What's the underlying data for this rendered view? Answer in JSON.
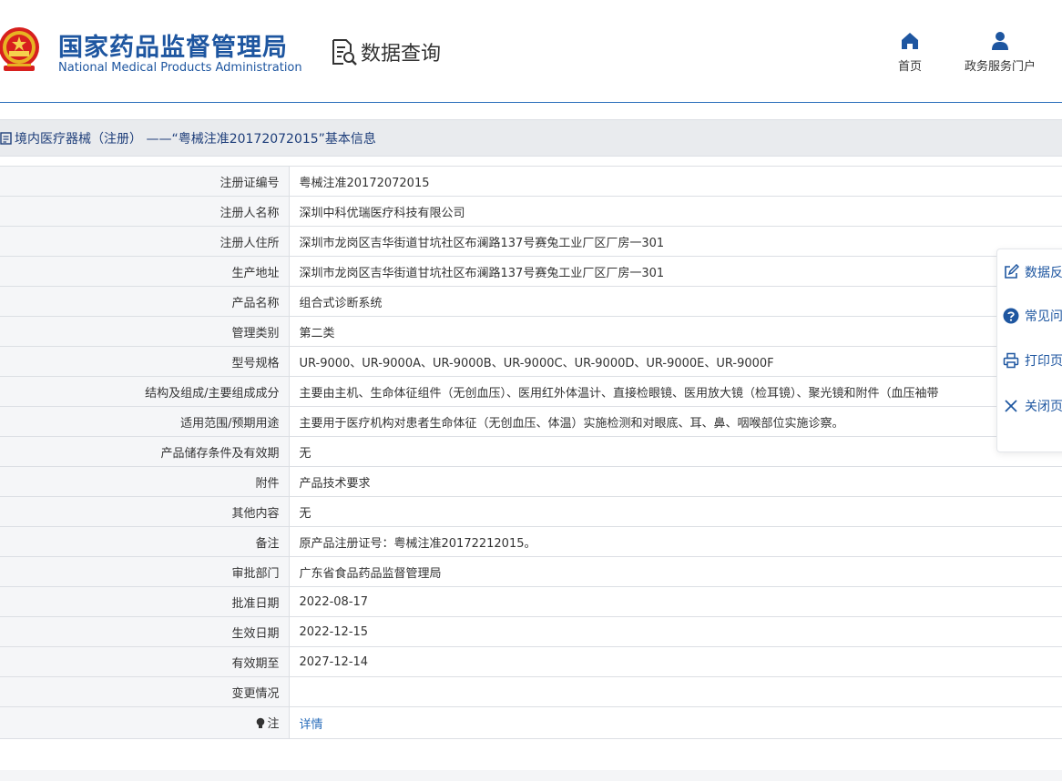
{
  "header": {
    "org_cn": "国家药品监督管理局",
    "org_en": "National Medical Products Administration",
    "query_title": "数据查询",
    "nav": {
      "home_label": "首页",
      "portal_label": "政务服务门户"
    }
  },
  "titlebar": {
    "text": "境内医疗器械（注册） ——“粤械注准20172072015”基本信息"
  },
  "table": {
    "rows": [
      {
        "label": "注册证编号",
        "value": "粤械注准20172072015"
      },
      {
        "label": "注册人名称",
        "value": "深圳中科优瑞医疗科技有限公司"
      },
      {
        "label": "注册人住所",
        "value": "深圳市龙岗区吉华街道甘坑社区布澜路137号赛兔工业厂区厂房一301"
      },
      {
        "label": "生产地址",
        "value": "深圳市龙岗区吉华街道甘坑社区布澜路137号赛兔工业厂区厂房一301"
      },
      {
        "label": "产品名称",
        "value": "组合式诊断系统"
      },
      {
        "label": "管理类别",
        "value": "第二类"
      },
      {
        "label": "型号规格",
        "value": "UR-9000、UR-9000A、UR-9000B、UR-9000C、UR-9000D、UR-9000E、UR-9000F"
      },
      {
        "label": "结构及组成/主要组成成分",
        "value": "主要由主机、生命体征组件（无创血压）、医用红外体温计、直接检眼镜、医用放大镜（检耳镜）、聚光镜和附件（血压袖带"
      },
      {
        "label": "适用范围/预期用途",
        "value": "主要用于医疗机构对患者生命体征（无创血压、体温）实施检测和对眼底、耳、鼻、咽喉部位实施诊察。"
      },
      {
        "label": "产品储存条件及有效期",
        "value": "无"
      },
      {
        "label": "附件",
        "value": "产品技术要求"
      },
      {
        "label": "其他内容",
        "value": "无"
      },
      {
        "label": "备注",
        "value": "原产品注册证号：粤械注准20172212015。"
      },
      {
        "label": "审批部门",
        "value": "广东省食品药品监督管理局"
      },
      {
        "label": "批准日期",
        "value": "2022-08-17"
      },
      {
        "label": "生效日期",
        "value": "2022-12-15"
      },
      {
        "label": "有效期至",
        "value": "2027-12-14"
      },
      {
        "label": "变更情况",
        "value": ""
      }
    ],
    "note_label": "注",
    "note_link": "详情"
  },
  "float_panel": {
    "items": [
      {
        "label": "数据反",
        "icon": "edit-icon"
      },
      {
        "label": "常见问",
        "icon": "question-icon"
      },
      {
        "label": "打印页",
        "icon": "print-icon"
      },
      {
        "label": "关闭页",
        "icon": "close-icon"
      }
    ]
  },
  "colors": {
    "brand_blue": "#1e56a0",
    "link_blue": "#2a6ebb",
    "label_bg": "#f5f6f8",
    "titlebar_bg": "#e9ebee"
  }
}
